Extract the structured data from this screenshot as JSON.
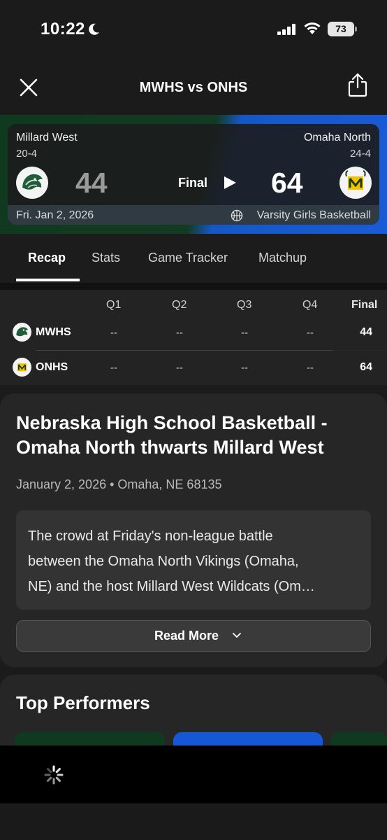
{
  "status_bar": {
    "time": "10:22",
    "battery": "73"
  },
  "header": {
    "title": "MWHS vs ONHS"
  },
  "game": {
    "home": {
      "name": "Millard West",
      "record": "20-4",
      "score": "44"
    },
    "away": {
      "name": "Omaha North",
      "record": "24-4",
      "score": "64"
    },
    "status": "Final",
    "date": "Fri. Jan 2, 2026",
    "type": "Varsity Girls Basketball"
  },
  "tabs": [
    "Recap",
    "Stats",
    "Game Tracker",
    "Matchup"
  ],
  "linescore": {
    "headers": [
      "Q1",
      "Q2",
      "Q3",
      "Q4",
      "Final"
    ],
    "rows": [
      {
        "team": "MWHS",
        "q": [
          "--",
          "--",
          "--",
          "--"
        ],
        "final": "44"
      },
      {
        "team": "ONHS",
        "q": [
          "--",
          "--",
          "--",
          "--"
        ],
        "final": "64"
      }
    ]
  },
  "recap": {
    "title_line1": "Nebraska High School Basketball -",
    "title_line2": "Omaha North thwarts Millard West",
    "meta": "January 2, 2026 • Omaha, NE 68135",
    "body_line1": "The crowd at Friday's non-league battle",
    "body_line2": "between the Omaha North Vikings (Omaha,",
    "body_line3": "NE) and the host Millard West Wildcats (Om…",
    "read_more": "Read More"
  },
  "performers": {
    "title": "Top Performers"
  },
  "colors": {
    "home_green": "#0f3a1f",
    "away_blue": "#1a5ad6",
    "background": "#1b1b1b"
  }
}
